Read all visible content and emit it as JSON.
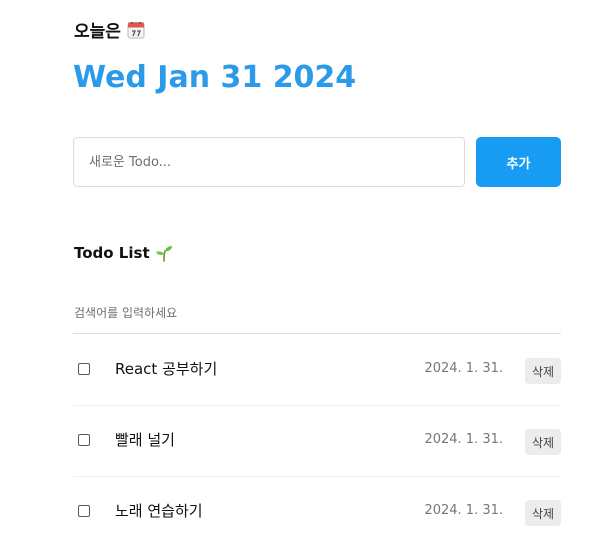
{
  "header": {
    "label": "오늘은",
    "calendar_icon": "calendar-icon",
    "date": "Wed Jan 31 2024"
  },
  "editor": {
    "placeholder": "새로운 Todo...",
    "value": "",
    "add_label": "추가"
  },
  "list": {
    "title": "Todo List",
    "title_icon": "sprout-icon",
    "search_placeholder": "검색어를 입력하세요",
    "items": [
      {
        "content": "React 공부하기",
        "date": "2024. 1. 31.",
        "done": false,
        "delete_label": "삭제"
      },
      {
        "content": "빨래 널기",
        "date": "2024. 1. 31.",
        "done": false,
        "delete_label": "삭제"
      },
      {
        "content": "노래 연습하기",
        "date": "2024. 1. 31.",
        "done": false,
        "delete_label": "삭제"
      }
    ]
  },
  "colors": {
    "accent": "#189cf3",
    "date_title": "#2b9ae8",
    "delete_bg": "#ececec"
  }
}
